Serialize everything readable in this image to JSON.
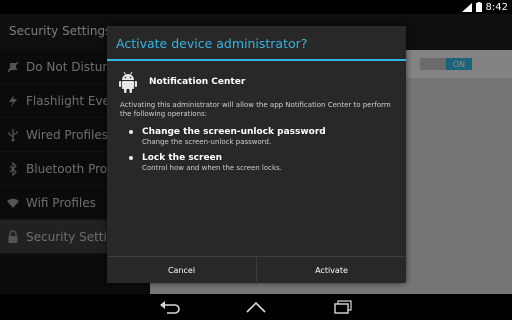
{
  "status_bar": {
    "time": "8:42",
    "icons": [
      "signal-icon",
      "battery-icon"
    ]
  },
  "app": {
    "title": "Security Settings",
    "sidebar": {
      "items": [
        {
          "label": "Do Not Disturb",
          "icon": "do-not-disturb-icon",
          "selected": false
        },
        {
          "label": "Flashlight Events",
          "icon": "flashlight-icon",
          "selected": false
        },
        {
          "label": "Wired Profiles",
          "icon": "usb-icon",
          "selected": false
        },
        {
          "label": "Bluetooth Profiles",
          "icon": "bluetooth-icon",
          "selected": false
        },
        {
          "label": "Wifi Profiles",
          "icon": "wifi-icon",
          "selected": false
        },
        {
          "label": "Security Settings",
          "icon": "lock-icon",
          "selected": true
        }
      ]
    },
    "content": {
      "toggle_label": "ON",
      "toggle_on": true
    }
  },
  "dialog": {
    "title": "Activate device administrator?",
    "app_name": "Notification Center",
    "app_icon": "android-icon",
    "description": "Activating this administrator will allow the app Notification Center to perform the following operations:",
    "permissions": [
      {
        "title": "Change the screen-unlock password",
        "description": "Change the screen-unlock password."
      },
      {
        "title": "Lock the screen",
        "description": "Control how and when the screen locks."
      }
    ],
    "buttons": {
      "cancel": "Cancel",
      "activate": "Activate"
    }
  },
  "nav_bar": {
    "buttons": [
      "back-icon",
      "home-icon",
      "recents-icon"
    ]
  },
  "colors": {
    "accent": "#33b5e5",
    "dialog_bg": "#282828"
  }
}
